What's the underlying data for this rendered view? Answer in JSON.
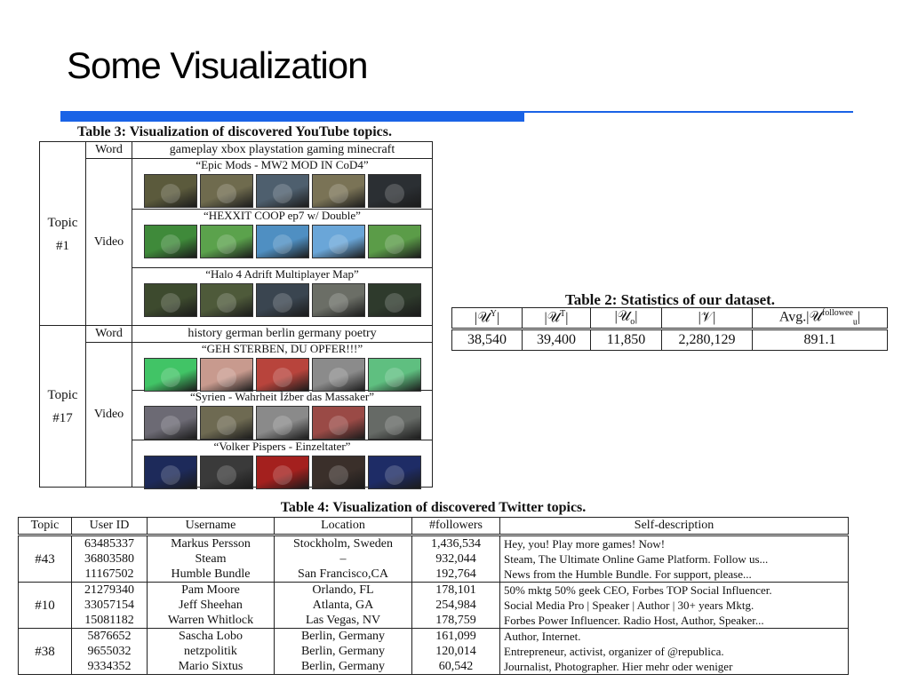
{
  "slide": {
    "title": "Some Visualization"
  },
  "table3": {
    "caption": "Table 3: Visualization of discovered YouTube topics.",
    "word_label": "Word",
    "video_label": "Video",
    "topic_word": "Topic",
    "topics": [
      {
        "id": "#1",
        "words": "gameplay xbox playstation gaming minecraft",
        "videos": [
          {
            "title": "“Epic Mods - MW2 MOD IN CoD4”",
            "palette": [
              "#5b5a3c",
              "#6f6b4e",
              "#4e5f6e",
              "#7a7356",
              "#2b2f33"
            ]
          },
          {
            "title": "“HEXXIT COOP ep7 w/ Double”",
            "palette": [
              "#3f8a3a",
              "#5ba24c",
              "#4f8fc2",
              "#6aa6d8",
              "#5b9c48"
            ]
          },
          {
            "title": "“Halo 4 Adrift Multiplayer Map”",
            "palette": [
              "#3d4a2e",
              "#4e5a3a",
              "#3a4550",
              "#6b6e66",
              "#2e3a2c"
            ]
          }
        ]
      },
      {
        "id": "#17",
        "words": "history german berlin germany poetry",
        "videos": [
          {
            "title": "“GEH STERBEN, DU OPFER!!!”",
            "palette": [
              "#41c466",
              "#c89a8e",
              "#b8443c",
              "#8b8b8b",
              "#5fbf80"
            ]
          },
          {
            "title": "“Syrien - Wahrheit Ìźber das Massaker”",
            "palette": [
              "#6c6a74",
              "#6e6a52",
              "#8a8a8a",
              "#9a4a46",
              "#666a66"
            ]
          },
          {
            "title": "“Volker Pispers - Einzeltater”",
            "palette": [
              "#1d2a5a",
              "#3a3a3a",
              "#a4201e",
              "#3a2f2a",
              "#1e2c66"
            ]
          }
        ]
      }
    ]
  },
  "table2": {
    "caption": "Table 2: Statistics of our dataset.",
    "headers": [
      {
        "base": "|𝒰",
        "sup": "Y",
        "sub": "",
        "end": "|"
      },
      {
        "base": "|𝒰",
        "sup": "T",
        "sub": "",
        "end": "|"
      },
      {
        "base": "|𝒰",
        "sup": "",
        "sub": "o",
        "end": "|"
      },
      {
        "base": "|𝒱|",
        "sup": "",
        "sub": "",
        "end": ""
      },
      {
        "base": "Avg.|𝒰",
        "sup": "followee",
        "sub": "u",
        "end": "|"
      }
    ],
    "values": [
      "38,540",
      "39,400",
      "11,850",
      "2,280,129",
      "891.1"
    ]
  },
  "table4": {
    "caption": "Table 4: Visualization of discovered Twitter topics.",
    "columns": [
      "Topic",
      "User ID",
      "Username",
      "Location",
      "#followers",
      "Self-description"
    ],
    "groups": [
      {
        "topic": "#43",
        "rows": [
          {
            "user_id": "63485337",
            "username": "Markus Persson",
            "location": "Stockholm, Sweden",
            "followers": "1,436,534",
            "desc": "Hey, you! Play more games! Now!"
          },
          {
            "user_id": "36803580",
            "username": "Steam",
            "location": "–",
            "followers": "932,044",
            "desc": "Steam, The Ultimate Online Game Platform. Follow us..."
          },
          {
            "user_id": "11167502",
            "username": "Humble Bundle",
            "location": "San Francisco,CA",
            "followers": "192,764",
            "desc": "News from the Humble Bundle. For support, please..."
          }
        ]
      },
      {
        "topic": "#10",
        "rows": [
          {
            "user_id": "21279340",
            "username": "Pam Moore",
            "location": "Orlando, FL",
            "followers": "178,101",
            "desc": "50% mktg 50% geek CEO, Forbes TOP Social Influencer."
          },
          {
            "user_id": "33057154",
            "username": "Jeff Sheehan",
            "location": "Atlanta, GA",
            "followers": "254,984",
            "desc": "Social Media Pro | Speaker | Author | 30+ years Mktg."
          },
          {
            "user_id": "15081182",
            "username": "Warren Whitlock",
            "location": "Las Vegas, NV",
            "followers": "178,759",
            "desc": "Forbes Power Influencer. Radio Host, Author, Speaker..."
          }
        ]
      },
      {
        "topic": "#38",
        "rows": [
          {
            "user_id": "5876652",
            "username": "Sascha Lobo",
            "location": "Berlin, Germany",
            "followers": "161,099",
            "desc": "Author, Internet."
          },
          {
            "user_id": "9655032",
            "username": "netzpolitik",
            "location": "Berlin, Germany",
            "followers": "120,014",
            "desc": "Entrepreneur, activist, organizer of @republica."
          },
          {
            "user_id": "9334352",
            "username": "Mario Sixtus",
            "location": "Berlin, Germany",
            "followers": "60,542",
            "desc": "Journalist, Photographer. Hier mehr oder weniger"
          }
        ]
      }
    ]
  }
}
